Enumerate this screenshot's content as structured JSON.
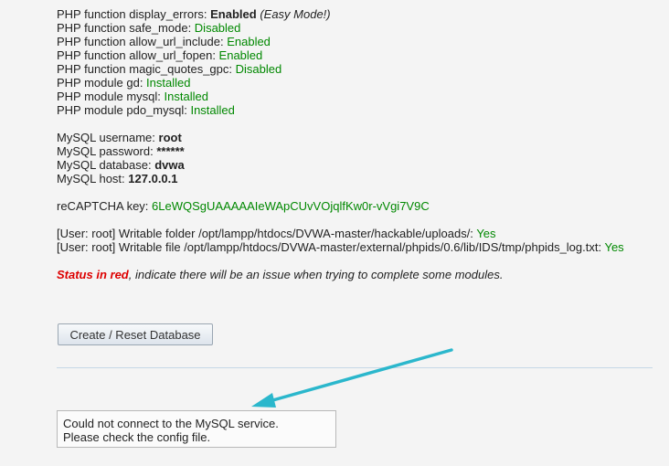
{
  "php": [
    {
      "label": "PHP function display_errors: ",
      "value": "Enabled",
      "note": " (Easy Mode!)"
    },
    {
      "label": "PHP function safe_mode: ",
      "value": "Disabled"
    },
    {
      "label": "PHP function allow_url_include: ",
      "value": "Enabled"
    },
    {
      "label": "PHP function allow_url_fopen: ",
      "value": "Enabled"
    },
    {
      "label": "PHP function magic_quotes_gpc: ",
      "value": "Disabled"
    },
    {
      "label": "PHP module gd: ",
      "value": "Installed"
    },
    {
      "label": "PHP module mysql: ",
      "value": "Installed"
    },
    {
      "label": "PHP module pdo_mysql: ",
      "value": "Installed"
    }
  ],
  "mysql": [
    {
      "label": "MySQL username: ",
      "value": "root"
    },
    {
      "label": "MySQL password: ",
      "value": "******"
    },
    {
      "label": "MySQL database: ",
      "value": "dvwa"
    },
    {
      "label": "MySQL host: ",
      "value": "127.0.0.1"
    }
  ],
  "recaptcha": {
    "label": "reCAPTCHA key: ",
    "value": "6LeWQSgUAAAAAIeWApCUvVOjqlfKw0r-vVgi7V9C"
  },
  "writable": [
    {
      "label": "[User: root] Writable folder /opt/lampp/htdocs/DVWA-master/hackable/uploads/: ",
      "value": "Yes"
    },
    {
      "label": "[User: root] Writable file /opt/lampp/htdocs/DVWA-master/external/phpids/0.6/lib/IDS/tmp/phpids_log.txt: ",
      "value": "Yes"
    }
  ],
  "status_note": {
    "red": "Status in red",
    "rest": ", indicate there will be an issue when trying to complete some modules."
  },
  "button": {
    "label": "Create / Reset Database"
  },
  "message": {
    "line1": "Could not connect to the MySQL service.",
    "line2": "Please check the config file."
  },
  "colors": {
    "ok": "#008800",
    "bad": "#dd0000",
    "arrow": "#2bb7cc"
  }
}
